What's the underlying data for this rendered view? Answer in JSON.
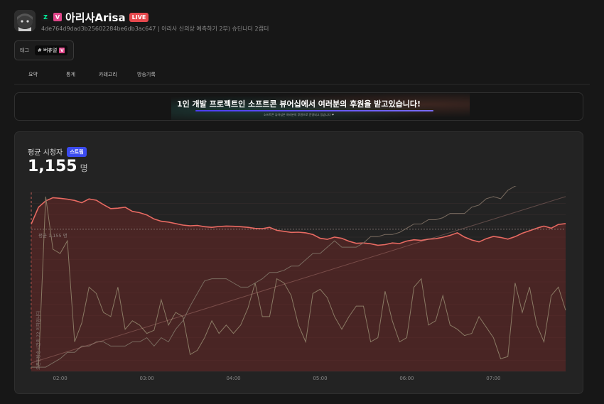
{
  "channel": {
    "name": "아리사Arisa",
    "live_label": "LIVE",
    "id": "4de764d9dad3b25602284be6db3ac647",
    "description": "아리사 신의상 예측하기 2부) 슈딘나더 2캡터",
    "platform_icons": [
      "chzzk-icon",
      "v-badge-icon"
    ]
  },
  "tags": {
    "label": "태그",
    "items": [
      {
        "text": "# 버츄얼",
        "icon": "v-badge-icon"
      }
    ]
  },
  "tabs": [
    {
      "label": "요약"
    },
    {
      "label": "통계"
    },
    {
      "label": "카테고리"
    },
    {
      "label": "방송기록"
    }
  ],
  "banner": {
    "main_text": "1인 개발 프로젝트인 소프트콘 뷰어십에서 여러분의 후원을 받고있습니다!",
    "sub_text": "소프트콘 뷰어십은 여러분의 후원으로 운영되고 있습니다 ❤"
  },
  "metric": {
    "label": "평균 시청자",
    "badge": "스트림",
    "value": "1,155",
    "unit": "명"
  },
  "colors": {
    "accent_line": "#e86a62",
    "secondary_lines": "#8a7a64",
    "live": "#e5484d",
    "badge_blue": "#3b4bf0"
  },
  "chart_data": {
    "type": "line",
    "x_tick_labels": [
      "02:00",
      "03:00",
      "04:00",
      "05:00",
      "06:00",
      "07:00"
    ],
    "x_range": [
      "01:40",
      "07:50"
    ],
    "grid": true,
    "average_line": {
      "label": "평균 1,155 명",
      "value": 1155
    },
    "left_vertical_label": "오픈된방송시간의 22 이하입니다",
    "series": [
      {
        "style": "red-area",
        "x": [
          "01:40",
          "01:45",
          "01:50",
          "01:55",
          "02:00",
          "02:05",
          "02:10",
          "02:15",
          "02:20",
          "02:25",
          "02:30",
          "02:35",
          "02:40",
          "02:45",
          "02:50",
          "02:55",
          "03:00",
          "03:05",
          "03:10",
          "03:15",
          "03:20",
          "03:25",
          "03:30",
          "03:35",
          "03:40",
          "03:45",
          "03:50",
          "03:55",
          "04:00",
          "04:05",
          "04:10",
          "04:15",
          "04:20",
          "04:25",
          "04:30",
          "04:35",
          "04:40",
          "04:45",
          "04:50",
          "04:55",
          "05:00",
          "05:05",
          "05:10",
          "05:15",
          "05:20",
          "05:25",
          "05:30",
          "05:35",
          "05:40",
          "05:45",
          "05:50",
          "05:55",
          "06:00",
          "06:05",
          "06:10",
          "06:15",
          "06:20",
          "06:25",
          "06:30",
          "06:35",
          "06:40",
          "06:45",
          "06:50",
          "06:55",
          "07:00",
          "07:05",
          "07:10",
          "07:15",
          "07:20",
          "07:25",
          "07:30",
          "07:35",
          "07:40",
          "07:45",
          "07:50"
        ],
        "values": [
          1180,
          1260,
          1290,
          1305,
          1302,
          1298,
          1292,
          1281,
          1299,
          1293,
          1272,
          1253,
          1255,
          1260,
          1240,
          1234,
          1223,
          1204,
          1193,
          1189,
          1182,
          1175,
          1171,
          1173,
          1167,
          1164,
          1168,
          1170,
          1169,
          1167,
          1164,
          1159,
          1158,
          1164,
          1150,
          1145,
          1140,
          1141,
          1138,
          1130,
          1112,
          1107,
          1118,
          1112,
          1098,
          1088,
          1090,
          1086,
          1079,
          1082,
          1090,
          1087,
          1099,
          1105,
          1102,
          1108,
          1110,
          1117,
          1126,
          1138,
          1118,
          1104,
          1095,
          1110,
          1121,
          1116,
          1108,
          1120,
          1136,
          1148,
          1160,
          1170,
          1160,
          1178,
          1182
        ]
      },
      {
        "style": "brown-volatile",
        "x": [
          "01:40",
          "01:45",
          "01:50",
          "01:55",
          "02:00",
          "02:05",
          "02:10",
          "02:15",
          "02:20",
          "02:25",
          "02:30",
          "02:35",
          "02:40",
          "02:45",
          "02:50",
          "02:55",
          "03:00",
          "03:05",
          "03:10",
          "03:15",
          "03:20",
          "03:25",
          "03:30",
          "03:35",
          "03:40",
          "03:45",
          "03:50",
          "03:55",
          "04:00",
          "04:05",
          "04:10",
          "04:15",
          "04:20",
          "04:25",
          "04:30",
          "04:35",
          "04:40",
          "04:45",
          "04:50",
          "04:55",
          "05:00",
          "05:05",
          "05:10",
          "05:15",
          "05:20",
          "05:25",
          "05:30",
          "05:35",
          "05:40",
          "05:45",
          "05:50",
          "05:55",
          "06:00",
          "06:05",
          "06:10",
          "06:15",
          "06:20",
          "06:25",
          "06:30",
          "06:35",
          "06:40",
          "06:45",
          "06:50",
          "06:55",
          "07:00",
          "07:05",
          "07:10",
          "07:15",
          "07:20",
          "07:25",
          "07:30",
          "07:35",
          "07:40",
          "07:45",
          "07:50"
        ],
        "values": [
          500,
          500,
          1310,
          1060,
          1040,
          1100,
          620,
          710,
          880,
          850,
          760,
          740,
          880,
          680,
          720,
          700,
          660,
          675,
          820,
          700,
          760,
          740,
          560,
          580,
          640,
          720,
          660,
          700,
          660,
          700,
          780,
          900,
          740,
          740,
          920,
          900,
          840,
          700,
          620,
          850,
          870,
          830,
          740,
          680,
          740,
          790,
          790,
          620,
          640,
          860,
          720,
          620,
          640,
          880,
          920,
          700,
          720,
          840,
          700,
          680,
          650,
          660,
          740,
          690,
          640,
          540,
          550,
          900,
          760,
          880,
          700,
          620,
          840,
          880,
          770
        ]
      },
      {
        "style": "brown-steps",
        "x": [
          "01:40",
          "01:45",
          "01:50",
          "01:55",
          "02:00",
          "02:05",
          "02:10",
          "02:15",
          "02:20",
          "02:25",
          "02:30",
          "02:35",
          "02:40",
          "02:45",
          "02:50",
          "02:55",
          "03:00",
          "03:05",
          "03:10",
          "03:15",
          "03:20",
          "03:25",
          "03:30",
          "03:35",
          "03:40",
          "03:45",
          "03:50",
          "03:55",
          "04:00",
          "04:05",
          "04:10",
          "04:15",
          "04:20",
          "04:25",
          "04:30",
          "04:35",
          "04:40",
          "04:45",
          "04:50",
          "04:55",
          "05:00",
          "05:05",
          "05:10",
          "05:15",
          "05:20",
          "05:25",
          "05:30",
          "05:35",
          "05:40",
          "05:45",
          "05:50",
          "05:55",
          "06:00",
          "06:05",
          "06:10",
          "06:15",
          "06:20",
          "06:25",
          "06:30",
          "06:35",
          "06:40",
          "06:45",
          "06:50",
          "06:55",
          "07:00",
          "07:05",
          "07:10",
          "07:15",
          "07:20",
          "07:25",
          "07:30",
          "07:35",
          "07:40",
          "07:45",
          "07:50"
        ],
        "values": [
          500,
          500,
          500,
          520,
          540,
          570,
          570,
          600,
          600,
          620,
          620,
          600,
          600,
          600,
          620,
          620,
          640,
          600,
          640,
          620,
          680,
          720,
          790,
          850,
          910,
          920,
          920,
          920,
          900,
          880,
          880,
          900,
          920,
          950,
          950,
          960,
          980,
          980,
          1010,
          1040,
          1040,
          1070,
          1100,
          1070,
          1070,
          1070,
          1090,
          1120,
          1120,
          1130,
          1130,
          1140,
          1160,
          1180,
          1180,
          1200,
          1200,
          1210,
          1230,
          1230,
          1230,
          1260,
          1270,
          1300,
          1310,
          1300,
          1340,
          1360,
          1370,
          1380,
          1390,
          1400,
          1400,
          1410,
          1410
        ]
      },
      {
        "style": "faint-trend",
        "x": [
          "01:40",
          "07:50"
        ],
        "values": [
          520,
          1310
        ]
      }
    ]
  }
}
